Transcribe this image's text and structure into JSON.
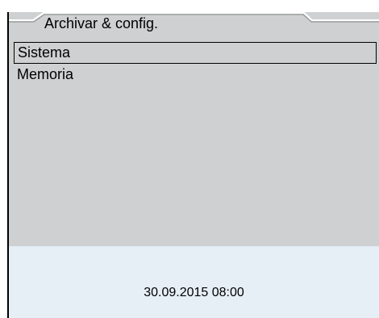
{
  "header": {
    "title": "Archivar & config."
  },
  "menu": {
    "items": [
      {
        "label": "Sistema",
        "selected": true
      },
      {
        "label": "Memoria",
        "selected": false
      }
    ]
  },
  "status": {
    "datetime": "30.09.2015 08:00"
  }
}
